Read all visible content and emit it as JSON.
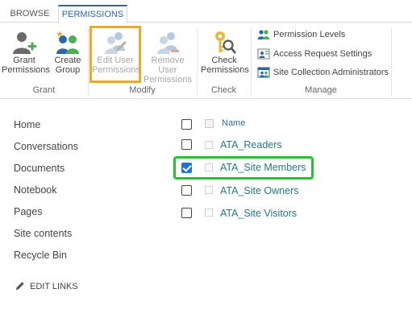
{
  "tabs": [
    {
      "label": "BROWSE",
      "active": false
    },
    {
      "label": "PERMISSIONS",
      "active": true
    }
  ],
  "ribbon": {
    "groups": {
      "grant": "Grant",
      "modify": "Modify",
      "check": "Check",
      "manage": "Manage"
    },
    "grant_permissions": {
      "line1": "Grant",
      "line2": "Permissions"
    },
    "create_group": {
      "line1": "Create",
      "line2": "Group"
    },
    "edit_user_permissions": {
      "line1": "Edit User",
      "line2": "Permissions",
      "disabled": true
    },
    "remove_user_permissions": {
      "line1": "Remove User",
      "line2": "Permissions",
      "disabled": true
    },
    "check_permissions": {
      "line1": "Check",
      "line2": "Permissions"
    },
    "manage_items": [
      {
        "label": "Permission Levels",
        "icon": "people-group-icon"
      },
      {
        "label": "Access Request Settings",
        "icon": "access-request-icon"
      },
      {
        "label": "Site Collection Administrators",
        "icon": "site-admins-icon"
      }
    ]
  },
  "nav": {
    "items": [
      "Home",
      "Conversations",
      "Documents",
      "Notebook",
      "Pages",
      "Site contents",
      "Recycle Bin"
    ],
    "edit_links": "EDIT LINKS"
  },
  "list": {
    "header": "Name",
    "groups": [
      {
        "name": "ATA_Readers",
        "checked": false
      },
      {
        "name": "ATA_Site Members",
        "checked": true
      },
      {
        "name": "ATA_Site Owners",
        "checked": false
      },
      {
        "name": "ATA_Site Visitors",
        "checked": false
      }
    ]
  },
  "colors": {
    "accent": "#2a67a8",
    "link": "#1f7a8c",
    "focus_orange": "#f0a828",
    "focus_green": "#25c22e",
    "checkbox_checked": "#1a73e8"
  }
}
